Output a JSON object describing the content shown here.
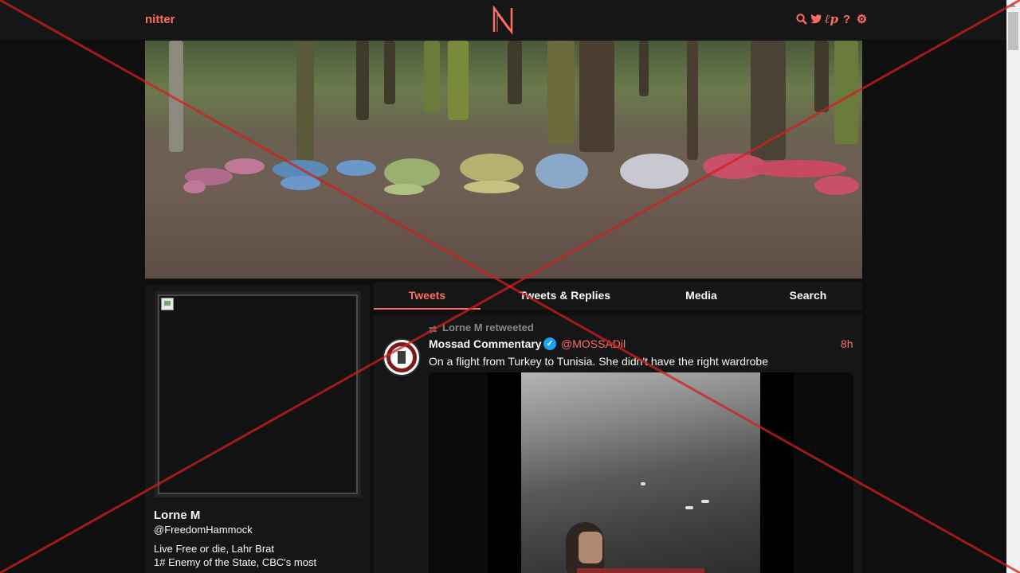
{
  "navbar": {
    "logo_text": "nitter",
    "logo_letter": "N",
    "icons": [
      "search-icon",
      "twitter-icon",
      "rss-icon",
      "help-icon",
      "gear-icon"
    ]
  },
  "profile": {
    "name": "Lorne M",
    "handle": "@FreedomHammock",
    "bio_line1": "Live Free or die, Lahr Brat",
    "bio_line2": "1# Enemy of the State, CBC's most"
  },
  "tabs": [
    {
      "label": "Tweets",
      "active": true
    },
    {
      "label": "Tweets & Replies",
      "active": false
    },
    {
      "label": "Media",
      "active": false
    },
    {
      "label": "Search",
      "active": false
    }
  ],
  "tweet": {
    "retweet_label": "Lorne M retweeted",
    "author_name": "Mossad Commentary",
    "author_handle": "@MOSSADil",
    "time": "8h",
    "text": "On a flight from Turkey to Tunisia. She didn't have the right wardrobe"
  },
  "colors": {
    "accent": "#ff6c60",
    "background": "#0f0f0f",
    "panel": "#161616",
    "verified": "#1da1f2"
  }
}
